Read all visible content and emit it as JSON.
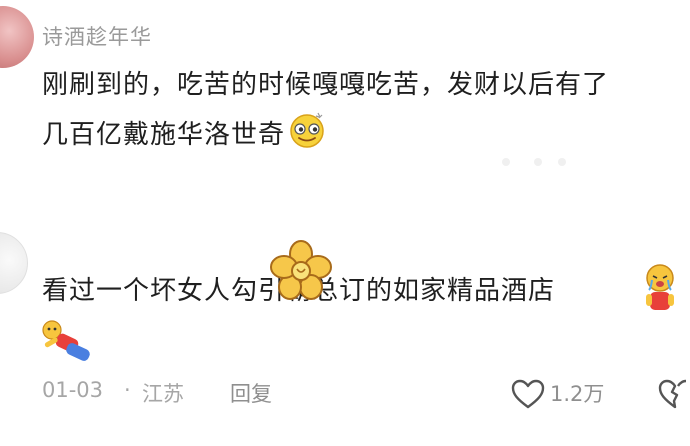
{
  "comment1": {
    "username": "诗酒趁年华",
    "text_line1": "刚刷到的，吃苦的时候嘎嘎吃苦，发财以后有了",
    "text_line2": "几百亿戴施华洛世奇"
  },
  "comment2": {
    "text_line1": "看过一个坏女人勾引霸总订的如家精品酒店"
  },
  "footer": {
    "date": "01-03",
    "separator": "·",
    "location": "江苏",
    "reply_label": "回复",
    "like_count": "1.2万"
  },
  "icons": {
    "emoji": "smiling-face-sticker",
    "like": "heart-outline-icon",
    "dislike": "broken-heart-outline-icon"
  },
  "colors": {
    "username": "#9a9a9a",
    "text": "#1f1f1f",
    "meta": "#a6a6a6"
  }
}
